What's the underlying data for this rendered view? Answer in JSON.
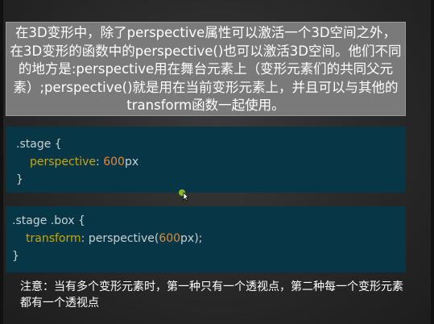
{
  "intro_text": "在3D变形中，除了perspective属性可以激活一个3D空间之外，在3D变形的函数中的perspective()也可以激活3D空间。他们不同的地方是:perspective用在舞台元素上（变形元素们的共同父元素）;perspective()就是用在当前变形元素上，并且可以与其他的transform函数一起使用。",
  "code_block_1": {
    "selector": ".stage {",
    "property": "perspective",
    "colon": ":",
    "value_num": "600",
    "value_unit": "px",
    "close": "}"
  },
  "code_block_2": {
    "selector": ".stage .box {",
    "property": "transform",
    "colon": ":",
    "value_pre": "perspective(",
    "value_num": "600",
    "value_post": "px);",
    "close": "}"
  },
  "note_text": "注意：当有多个变形元素时，第一种只有一个透视点，第二种每一个变形元素都有一个透视点",
  "colors": {
    "background": "#2b2b2b",
    "header_box": "#7a7a7a",
    "code_background": "#073646",
    "keyword": "#c9a800",
    "number": "#e08a3a"
  },
  "icons": [
    "mouse-cursor-icon"
  ]
}
